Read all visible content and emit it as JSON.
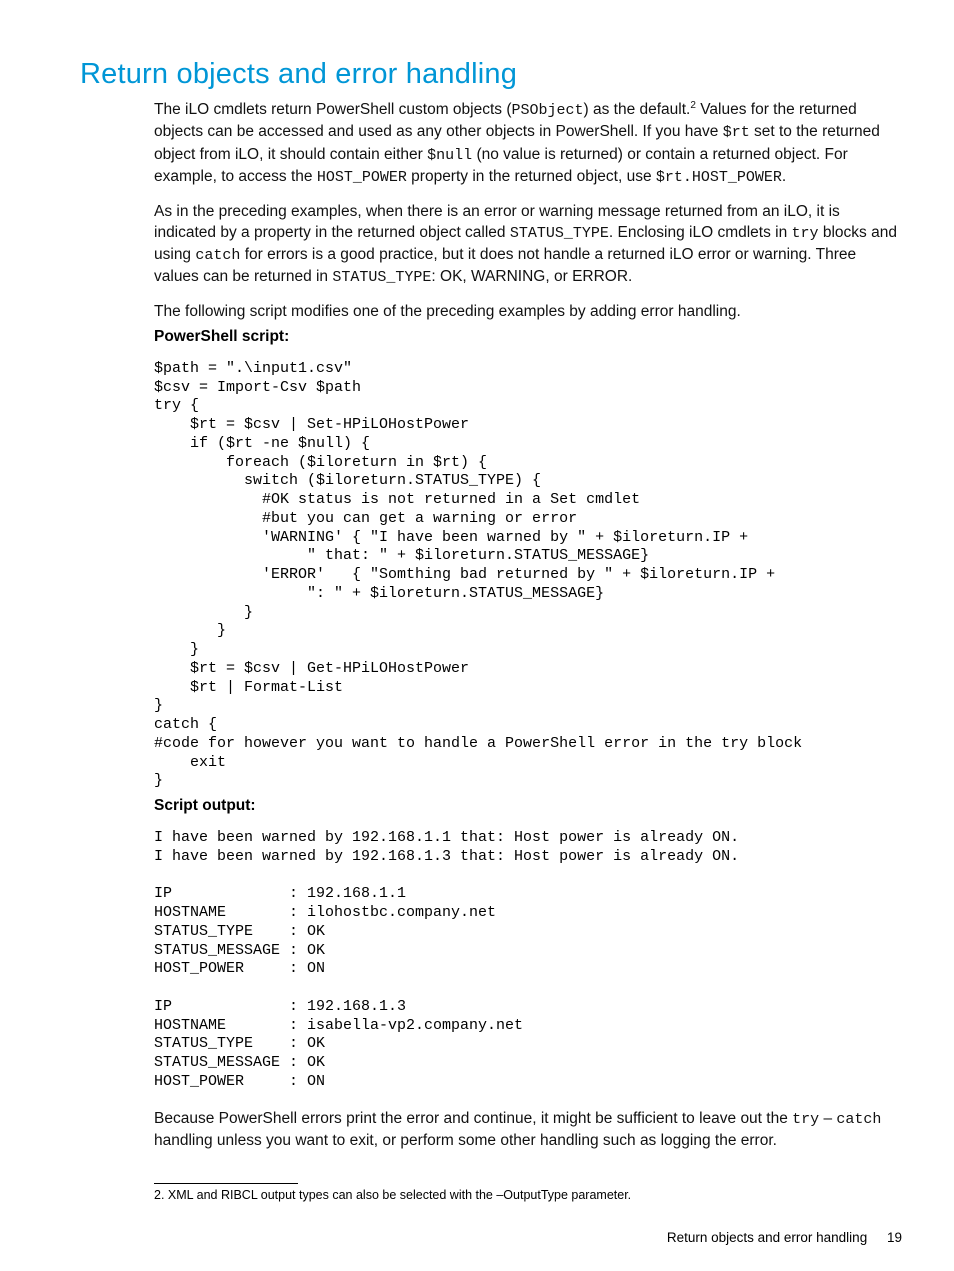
{
  "heading": "Return objects and error handling",
  "para1_a": "The iLO cmdlets return PowerShell custom objects (",
  "para1_code1": "PSObject",
  "para1_b": ") as the default.",
  "para1_sup": "2",
  "para1_c": " Values for the returned objects can be accessed and used as any other objects in PowerShell. If you have ",
  "para1_code2": "$rt",
  "para1_d": " set to the returned object from iLO, it should contain either ",
  "para1_code3": "$null",
  "para1_e": " (no value is returned) or contain a returned object. For example, to access the ",
  "para1_code4": "HOST_POWER",
  "para1_f": " property in the returned object, use ",
  "para1_code5": "$rt.HOST_POWER",
  "para1_g": ".",
  "para2_a": "As in the preceding examples, when there is an error or warning message returned from an iLO, it is indicated by a property in the returned object called ",
  "para2_code1": "STATUS_TYPE",
  "para2_b": ". Enclosing iLO cmdlets in ",
  "para2_code2": "try",
  "para2_c": " blocks and using ",
  "para2_code3": "catch",
  "para2_d": " for errors is a good practice, but it does not handle a returned iLO error or warning. Three values can be returned in ",
  "para2_code4": "STATUS_TYPE",
  "para2_e": ": OK, WARNING, or ERROR.",
  "para3": "The following script modifies one of the preceding examples by adding error handling.",
  "label_script": "PowerShell script:",
  "code_block": "$path = \".\\input1.csv\"\n$csv = Import-Csv $path\ntry {\n    $rt = $csv | Set-HPiLOHostPower\n    if ($rt -ne $null) {\n        foreach ($iloreturn in $rt) {\n          switch ($iloreturn.STATUS_TYPE) {\n            #OK status is not returned in a Set cmdlet\n            #but you can get a warning or error\n            'WARNING' { \"I have been warned by \" + $iloreturn.IP +\n                 \" that: \" + $iloreturn.STATUS_MESSAGE}\n            'ERROR'   { \"Somthing bad returned by \" + $iloreturn.IP +\n                 \": \" + $iloreturn.STATUS_MESSAGE}\n          }\n       }\n    }\n    $rt = $csv | Get-HPiLOHostPower\n    $rt | Format-List\n}\ncatch {\n#code for however you want to handle a PowerShell error in the try block\n    exit\n}",
  "label_output": "Script output:",
  "output_block": "I have been warned by 192.168.1.1 that: Host power is already ON.\nI have been warned by 192.168.1.3 that: Host power is already ON.\n\nIP             : 192.168.1.1\nHOSTNAME       : ilohostbc.company.net\nSTATUS_TYPE    : OK\nSTATUS_MESSAGE : OK\nHOST_POWER     : ON\n\nIP             : 192.168.1.3\nHOSTNAME       : isabella-vp2.company.net\nSTATUS_TYPE    : OK\nSTATUS_MESSAGE : OK\nHOST_POWER     : ON",
  "para4_a": "Because PowerShell errors print the error and continue, it might be sufficient to leave out the ",
  "para4_code1": "try",
  "para4_b": " – ",
  "para4_code2": "catch",
  "para4_c": " handling unless you want to exit, or perform some other handling such as logging the error.",
  "footnote_num": "2.",
  "footnote_text": "  XML and RIBCL output types can also be selected with the –OutputType parameter.",
  "footer_title": "Return objects and error handling",
  "footer_page": "19"
}
